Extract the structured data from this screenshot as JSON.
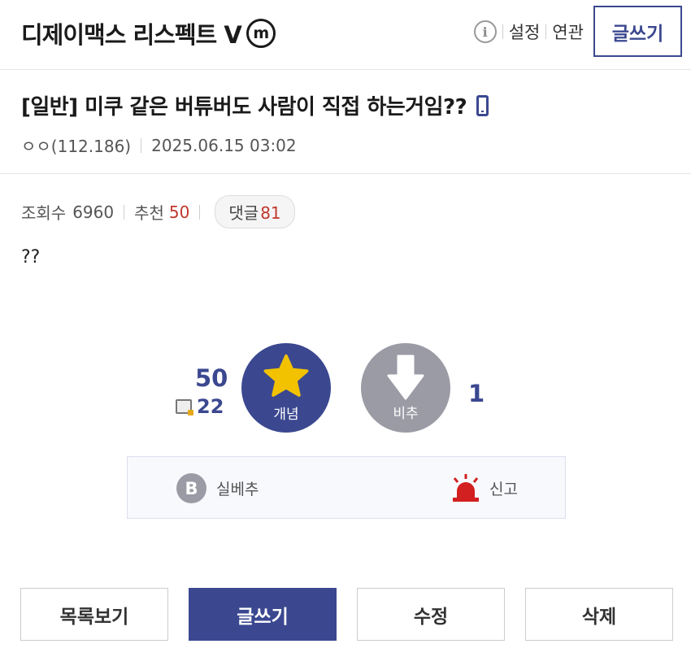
{
  "header": {
    "gallery_title": "디제이맥스 리스펙트 V",
    "minor_badge": "m",
    "info_glyph": "i",
    "settings_label": "설정",
    "related_label": "연관",
    "write_label": "글쓰기"
  },
  "post": {
    "title": "[일반] 미쿠 같은 버튜버도 사람이 직접 하는거임??",
    "author": "ㅇㅇ(112.186)",
    "datetime": "2025.06.15 03:02",
    "views_label": "조회수",
    "views": "6960",
    "recommend_label": "추천",
    "recommend": "50",
    "comments_label": "댓글",
    "comments": "81",
    "body": "??"
  },
  "vote": {
    "up_count": "50",
    "fix_count": "22",
    "up_label": "개념",
    "down_label": "비추",
    "down_count": "1"
  },
  "actions": {
    "best_glyph": "B",
    "best_label": "실베추",
    "report_label": "신고"
  },
  "bottom": {
    "list_label": "목록보기",
    "write_label": "글쓰기",
    "edit_label": "수정",
    "delete_label": "삭제"
  },
  "colors": {
    "brand": "#3b4890",
    "downvote": "#9a9ba5",
    "accent_red": "#c0392b",
    "star": "#f2c200"
  }
}
